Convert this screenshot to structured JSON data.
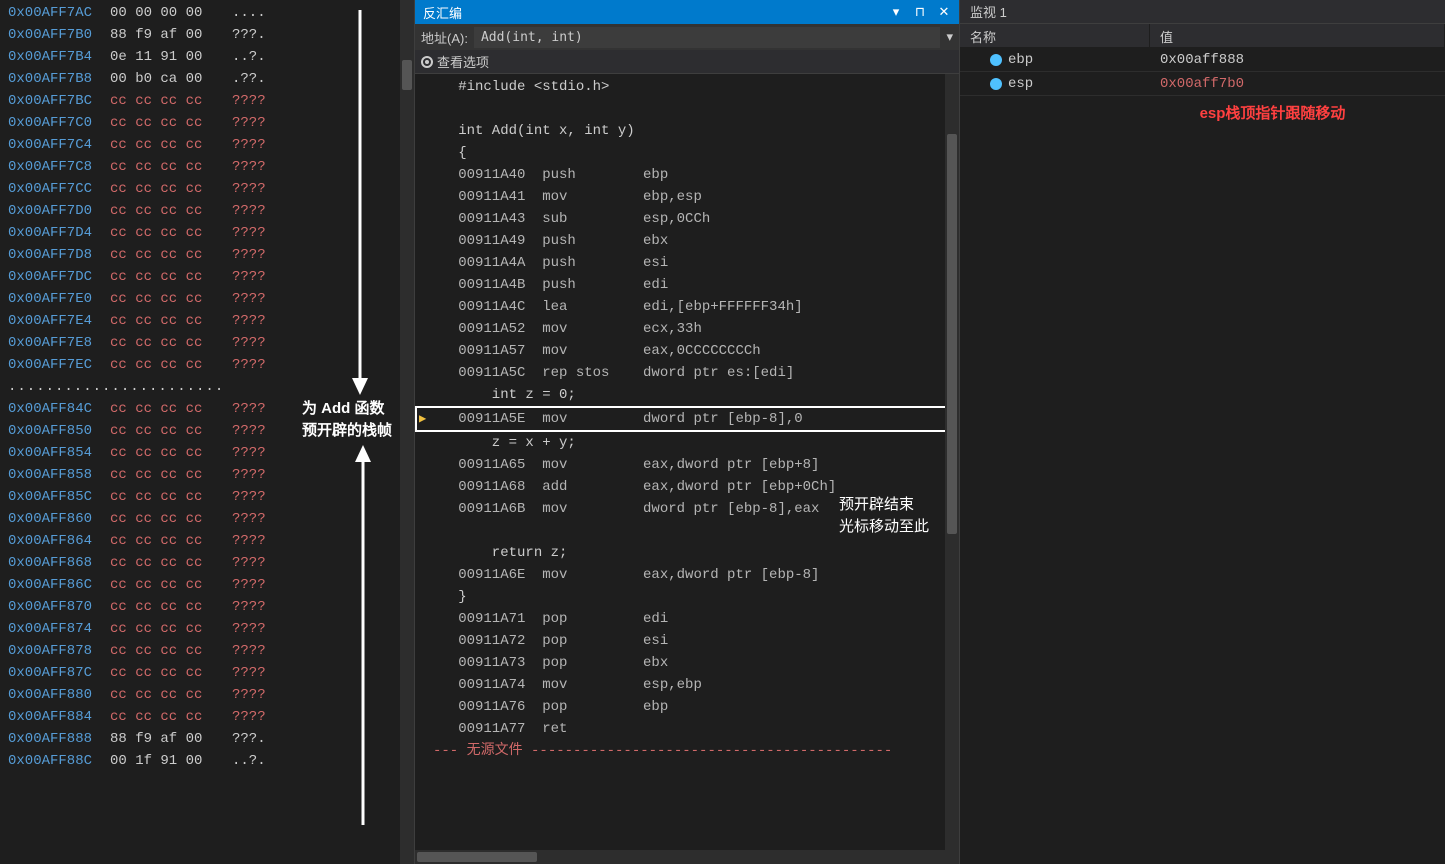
{
  "memory": {
    "top_rows": [
      {
        "addr": "0x00AFF7AC",
        "bytes": "00 00 00 00",
        "ascii": "....",
        "cc": false
      },
      {
        "addr": "0x00AFF7B0",
        "bytes": "88 f9 af 00",
        "ascii": "???.",
        "cc": false
      },
      {
        "addr": "0x00AFF7B4",
        "bytes": "0e 11 91 00",
        "ascii": "..?.",
        "cc": false
      },
      {
        "addr": "0x00AFF7B8",
        "bytes": "00 b0 ca 00",
        "ascii": ".??.",
        "cc": false
      },
      {
        "addr": "0x00AFF7BC",
        "bytes": "cc cc cc cc",
        "ascii": "????",
        "cc": true
      },
      {
        "addr": "0x00AFF7C0",
        "bytes": "cc cc cc cc",
        "ascii": "????",
        "cc": true
      },
      {
        "addr": "0x00AFF7C4",
        "bytes": "cc cc cc cc",
        "ascii": "????",
        "cc": true
      },
      {
        "addr": "0x00AFF7C8",
        "bytes": "cc cc cc cc",
        "ascii": "????",
        "cc": true
      },
      {
        "addr": "0x00AFF7CC",
        "bytes": "cc cc cc cc",
        "ascii": "????",
        "cc": true
      },
      {
        "addr": "0x00AFF7D0",
        "bytes": "cc cc cc cc",
        "ascii": "????",
        "cc": true
      },
      {
        "addr": "0x00AFF7D4",
        "bytes": "cc cc cc cc",
        "ascii": "????",
        "cc": true
      },
      {
        "addr": "0x00AFF7D8",
        "bytes": "cc cc cc cc",
        "ascii": "????",
        "cc": true
      },
      {
        "addr": "0x00AFF7DC",
        "bytes": "cc cc cc cc",
        "ascii": "????",
        "cc": true
      },
      {
        "addr": "0x00AFF7E0",
        "bytes": "cc cc cc cc",
        "ascii": "????",
        "cc": true
      },
      {
        "addr": "0x00AFF7E4",
        "bytes": "cc cc cc cc",
        "ascii": "????",
        "cc": true
      },
      {
        "addr": "0x00AFF7E8",
        "bytes": "cc cc cc cc",
        "ascii": "????",
        "cc": true
      },
      {
        "addr": "0x00AFF7EC",
        "bytes": "cc cc cc cc",
        "ascii": "????",
        "cc": true
      }
    ],
    "gap": ".......................",
    "bottom_rows": [
      {
        "addr": "0x00AFF84C",
        "bytes": "cc cc cc cc",
        "ascii": "????",
        "cc": true
      },
      {
        "addr": "0x00AFF850",
        "bytes": "cc cc cc cc",
        "ascii": "????",
        "cc": true
      },
      {
        "addr": "0x00AFF854",
        "bytes": "cc cc cc cc",
        "ascii": "????",
        "cc": true
      },
      {
        "addr": "0x00AFF858",
        "bytes": "cc cc cc cc",
        "ascii": "????",
        "cc": true
      },
      {
        "addr": "0x00AFF85C",
        "bytes": "cc cc cc cc",
        "ascii": "????",
        "cc": true
      },
      {
        "addr": "0x00AFF860",
        "bytes": "cc cc cc cc",
        "ascii": "????",
        "cc": true
      },
      {
        "addr": "0x00AFF864",
        "bytes": "cc cc cc cc",
        "ascii": "????",
        "cc": true
      },
      {
        "addr": "0x00AFF868",
        "bytes": "cc cc cc cc",
        "ascii": "????",
        "cc": true
      },
      {
        "addr": "0x00AFF86C",
        "bytes": "cc cc cc cc",
        "ascii": "????",
        "cc": true
      },
      {
        "addr": "0x00AFF870",
        "bytes": "cc cc cc cc",
        "ascii": "????",
        "cc": true
      },
      {
        "addr": "0x00AFF874",
        "bytes": "cc cc cc cc",
        "ascii": "????",
        "cc": true
      },
      {
        "addr": "0x00AFF878",
        "bytes": "cc cc cc cc",
        "ascii": "????",
        "cc": true
      },
      {
        "addr": "0x00AFF87C",
        "bytes": "cc cc cc cc",
        "ascii": "????",
        "cc": true
      },
      {
        "addr": "0x00AFF880",
        "bytes": "cc cc cc cc",
        "ascii": "????",
        "cc": true
      },
      {
        "addr": "0x00AFF884",
        "bytes": "cc cc cc cc",
        "ascii": "????",
        "cc": true
      },
      {
        "addr": "0x00AFF888",
        "bytes": "88 f9 af 00",
        "ascii": "???.",
        "cc": false
      },
      {
        "addr": "0x00AFF88C",
        "bytes": "00 1f 91 00",
        "ascii": "..?.",
        "cc": false
      }
    ],
    "annotation_line1": "为 Add 函数",
    "annotation_line2": "预开辟的栈帧"
  },
  "disasm": {
    "panel_title": "反汇编",
    "address_label": "地址(A):",
    "address_value": "Add(int, int)",
    "options_label": "查看选项",
    "lines": [
      {
        "type": "src",
        "text": "#include <stdio.h>"
      },
      {
        "type": "blank",
        "text": ""
      },
      {
        "type": "src",
        "text": "int Add(int x, int y)"
      },
      {
        "type": "src",
        "text": "{"
      },
      {
        "type": "asm",
        "addr": "00911A40",
        "mnem": "push",
        "ops": "ebp"
      },
      {
        "type": "asm",
        "addr": "00911A41",
        "mnem": "mov",
        "ops": "ebp,esp"
      },
      {
        "type": "asm",
        "addr": "00911A43",
        "mnem": "sub",
        "ops": "esp,0CCh"
      },
      {
        "type": "asm",
        "addr": "00911A49",
        "mnem": "push",
        "ops": "ebx"
      },
      {
        "type": "asm",
        "addr": "00911A4A",
        "mnem": "push",
        "ops": "esi"
      },
      {
        "type": "asm",
        "addr": "00911A4B",
        "mnem": "push",
        "ops": "edi"
      },
      {
        "type": "asm",
        "addr": "00911A4C",
        "mnem": "lea",
        "ops": "edi,[ebp+FFFFFF34h]"
      },
      {
        "type": "asm",
        "addr": "00911A52",
        "mnem": "mov",
        "ops": "ecx,33h"
      },
      {
        "type": "asm",
        "addr": "00911A57",
        "mnem": "mov",
        "ops": "eax,0CCCCCCCCh"
      },
      {
        "type": "asm",
        "addr": "00911A5C",
        "mnem": "rep stos",
        "ops": "dword ptr es:[edi]"
      },
      {
        "type": "src",
        "text": "    int z = 0;"
      },
      {
        "type": "asm",
        "addr": "00911A5E",
        "mnem": "mov",
        "ops": "dword ptr [ebp-8],0",
        "current": true
      },
      {
        "type": "src",
        "text": "    z = x + y;"
      },
      {
        "type": "asm",
        "addr": "00911A65",
        "mnem": "mov",
        "ops": "eax,dword ptr [ebp+8]"
      },
      {
        "type": "asm",
        "addr": "00911A68",
        "mnem": "add",
        "ops": "eax,dword ptr [ebp+0Ch]"
      },
      {
        "type": "asm",
        "addr": "00911A6B",
        "mnem": "mov",
        "ops": "dword ptr [ebp-8],eax"
      },
      {
        "type": "blank",
        "text": ""
      },
      {
        "type": "src",
        "text": "    return z;"
      },
      {
        "type": "asm",
        "addr": "00911A6E",
        "mnem": "mov",
        "ops": "eax,dword ptr [ebp-8]"
      },
      {
        "type": "src",
        "text": "}"
      },
      {
        "type": "asm",
        "addr": "00911A71",
        "mnem": "pop",
        "ops": "edi"
      },
      {
        "type": "asm",
        "addr": "00911A72",
        "mnem": "pop",
        "ops": "esi"
      },
      {
        "type": "asm",
        "addr": "00911A73",
        "mnem": "pop",
        "ops": "ebx"
      },
      {
        "type": "asm",
        "addr": "00911A74",
        "mnem": "mov",
        "ops": "esp,ebp"
      },
      {
        "type": "asm",
        "addr": "00911A76",
        "mnem": "pop",
        "ops": "ebp"
      },
      {
        "type": "asm",
        "addr": "00911A77",
        "mnem": "ret",
        "ops": ""
      }
    ],
    "nosrc_prefix": "--- ",
    "nosrc_text": "无源文件",
    "nosrc_dashes": " -------------------------------------------",
    "annot_line1": "预开辟结束",
    "annot_line2": "光标移动至此"
  },
  "watch": {
    "tab": "监视 1",
    "col_name": "名称",
    "col_value": "值",
    "rows": [
      {
        "name": "ebp",
        "value": "0x00aff888",
        "changed": false
      },
      {
        "name": "esp",
        "value": "0x00aff7b0",
        "changed": true
      }
    ],
    "annotation": "esp栈顶指针跟随移动"
  },
  "icons": {
    "dropdown": "▾",
    "pin": "📌",
    "close": "✕"
  }
}
